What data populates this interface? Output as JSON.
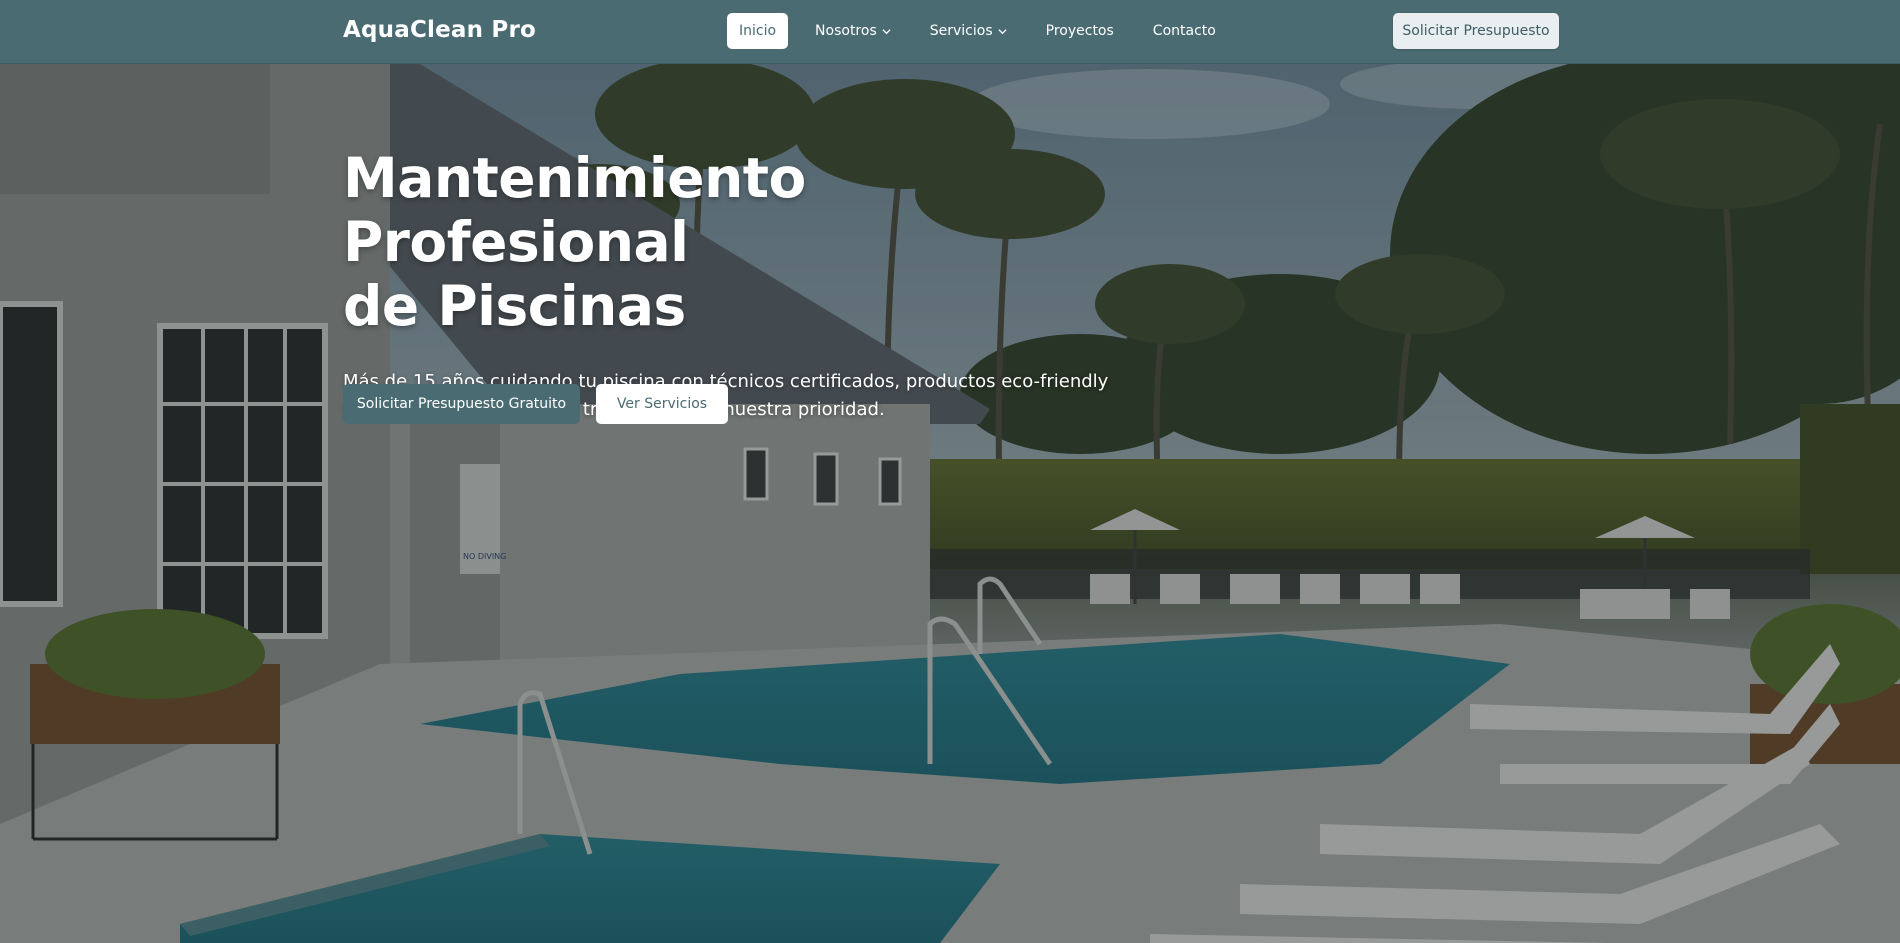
{
  "brand": {
    "name": "AquaClean Pro"
  },
  "nav": {
    "items": [
      {
        "label": "Inicio",
        "active": true,
        "has_dropdown": false
      },
      {
        "label": "Nosotros",
        "active": false,
        "has_dropdown": true
      },
      {
        "label": "Servicios",
        "active": false,
        "has_dropdown": true
      },
      {
        "label": "Proyectos",
        "active": false,
        "has_dropdown": false
      },
      {
        "label": "Contacto",
        "active": false,
        "has_dropdown": false
      }
    ],
    "cta_label": "Solicitar Presupuesto"
  },
  "hero": {
    "title_line1": "Mantenimiento Profesional",
    "title_line2": "de Piscinas",
    "subtitle": "Más de 15 años cuidando tu piscina con técnicos certificados, productos eco-friendly y precios competitivos. Tu tranquilidad es nuestra prioridad.",
    "primary_button": "Solicitar Presupuesto Gratuito",
    "secondary_button": "Ver Servicios",
    "sign_text": "NO DIVING"
  },
  "colors": {
    "navbar": "#4a6b72",
    "primary_button": "#4a6b72",
    "white": "#ffffff"
  }
}
